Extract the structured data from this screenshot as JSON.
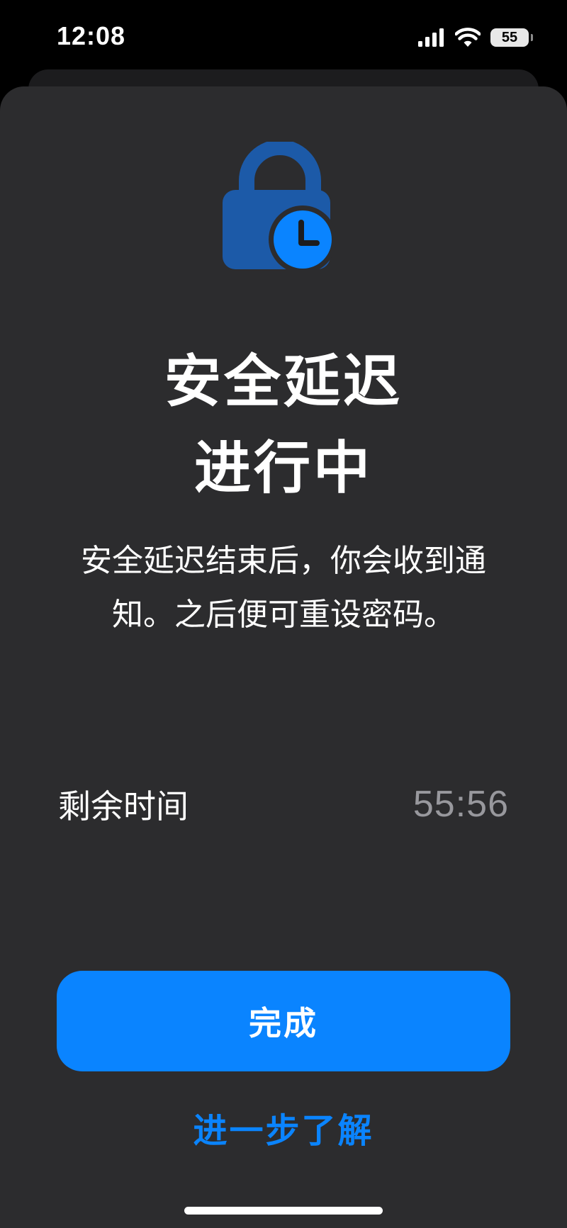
{
  "status_bar": {
    "time": "12:08",
    "battery_level": "55",
    "icons": [
      "cellular-signal-icon",
      "wifi-icon",
      "battery-icon"
    ]
  },
  "sheet": {
    "hero_icon": "lock-clock-icon",
    "title_line1": "安全延迟",
    "title_line2": "进行中",
    "description": "安全延迟结束后，你会收到通知。之后便可重设密码。",
    "remaining_label": "剩余时间",
    "remaining_value": "55:56",
    "done_label": "完成",
    "learn_more_label": "进一步了解"
  },
  "colors": {
    "accent": "#0a84ff",
    "sheet_background": "#2c2c2e",
    "lock_body": "#1c5aa8",
    "secondary_text": "#98989d"
  }
}
